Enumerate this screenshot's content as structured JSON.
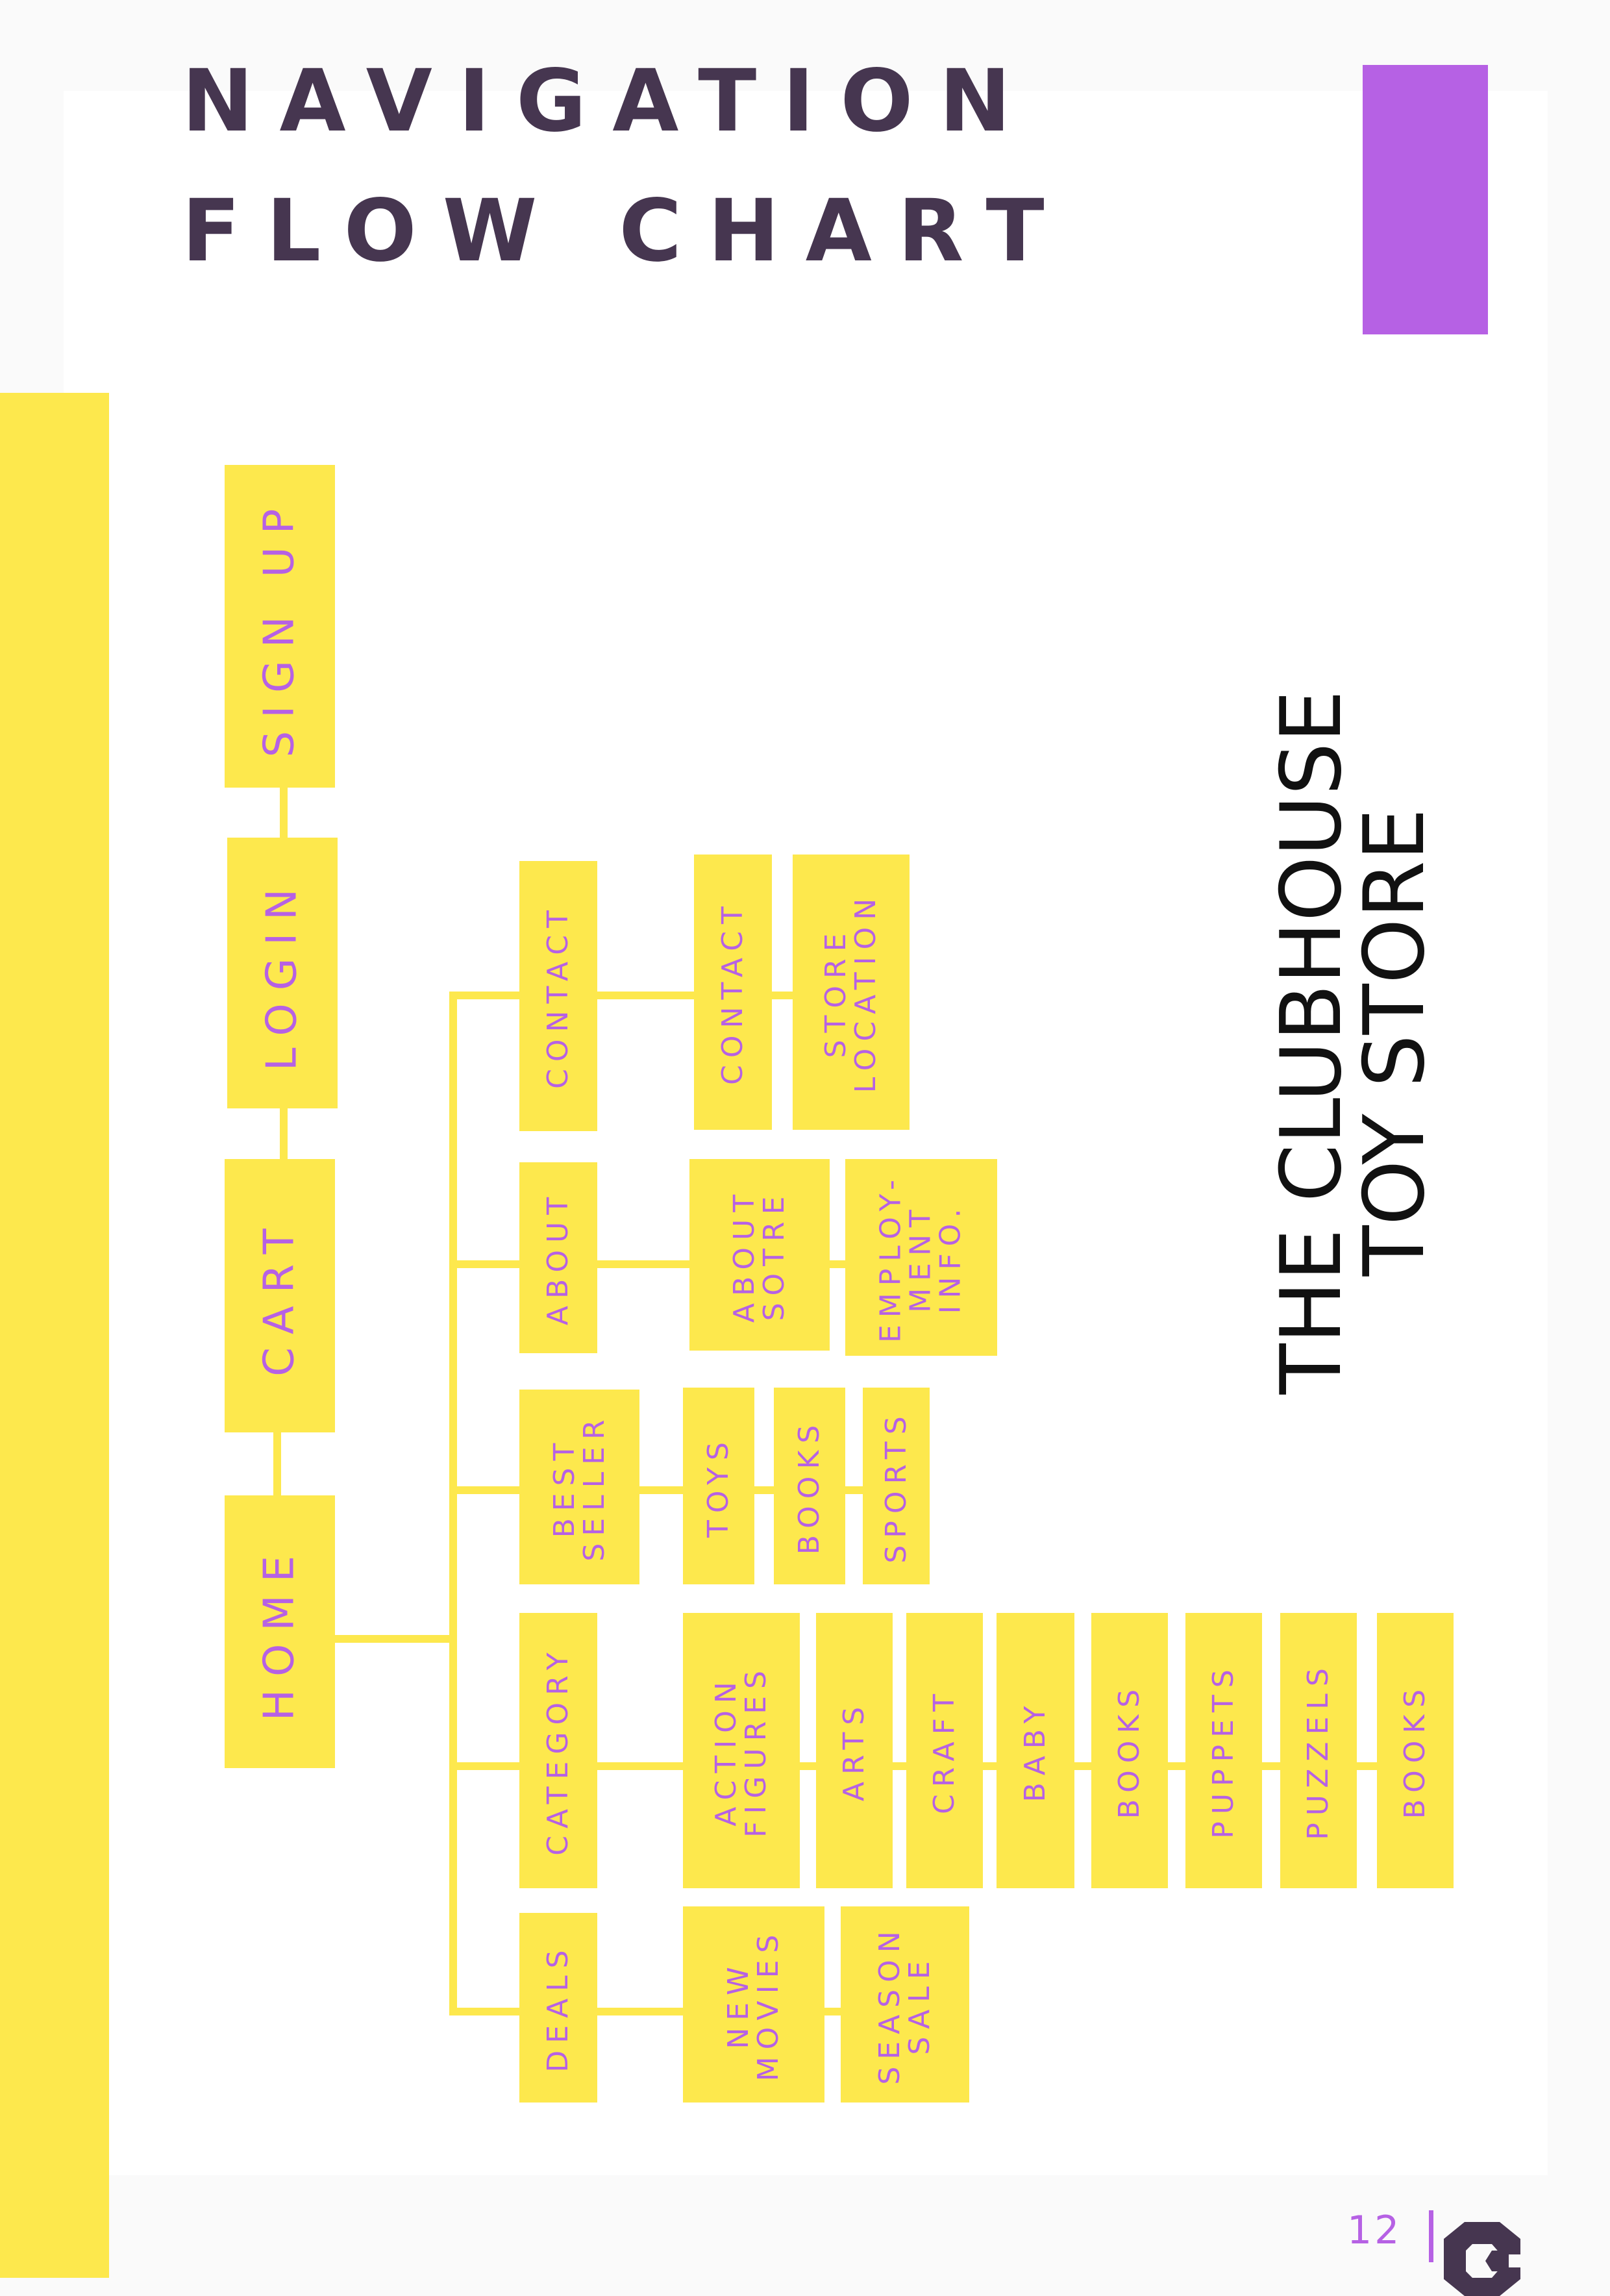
{
  "page": {
    "title_line1": "NAVIGATION",
    "title_line2": "FLOW CHART",
    "store_name": "THE CLUBHOUSE\nTOY STORE",
    "page_number": "12"
  },
  "colors": {
    "yellow": "#fde84d",
    "purple": "#b661e4",
    "dark": "#463650",
    "text": "#111111"
  },
  "icons": {
    "logo": "brand-logo-icon"
  },
  "nodes": {
    "top": {
      "signup": "SIGN UP",
      "login": "LOGIN",
      "cart": "CART",
      "home": "HOME"
    },
    "main": {
      "contact": "CONTACT",
      "about": "ABOUT",
      "best_seller": "BEST\nSELLER",
      "category": "CATEGORY",
      "deals": "DEALS"
    },
    "contact_sub": {
      "contact": "CONTACT",
      "store_location": "STORE\nLOCATION"
    },
    "about_sub": {
      "about_store": "ABOUT\nSOTRE",
      "employment": "EMPLOY-\nMENT\nINFO."
    },
    "best_seller_sub": {
      "toys": "TOYS",
      "books": "BOOKS",
      "sports": "SPORTS"
    },
    "category_sub": {
      "action_figures": "ACTION\nFIGURES",
      "arts": "ARTS",
      "craft": "CRAFT",
      "baby": "BABY",
      "books": "BOOKS",
      "puppets": "PUPPETS",
      "puzzels": "PUZZELS",
      "books2": "BOOKS"
    },
    "deals_sub": {
      "new_movies": "NEW\nMOVIES",
      "season_sale": "SEASON\nSALE"
    }
  }
}
